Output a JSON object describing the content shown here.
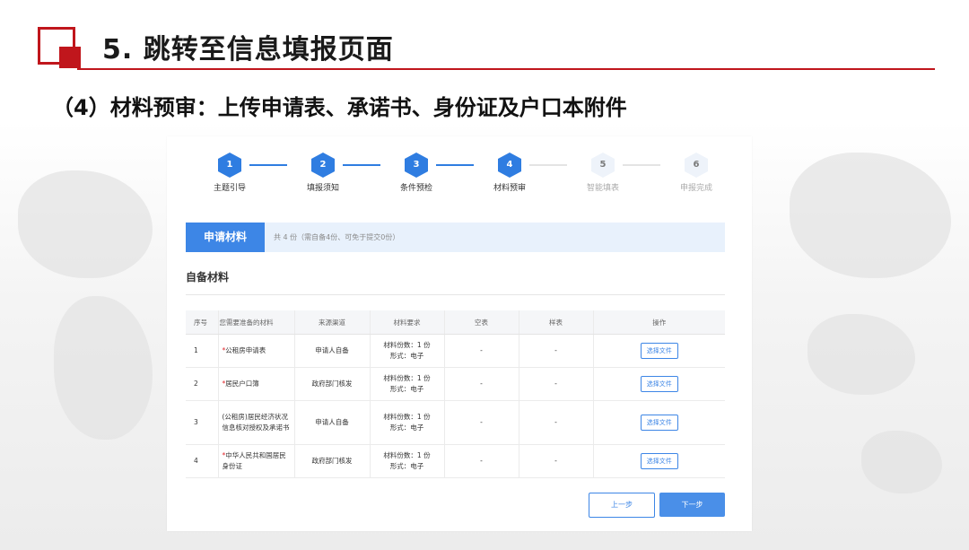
{
  "slide": {
    "title": "5. 跳转至信息填报页面",
    "subtitle": "（4）材料预审：上传申请表、承诺书、身份证及户口本附件"
  },
  "steps": [
    {
      "num": "1",
      "label": "主题引导",
      "state": "active"
    },
    {
      "num": "2",
      "label": "填报须知",
      "state": "active"
    },
    {
      "num": "3",
      "label": "条件预检",
      "state": "active"
    },
    {
      "num": "4",
      "label": "材料预审",
      "state": "active"
    },
    {
      "num": "5",
      "label": "智能填表",
      "state": "inactive"
    },
    {
      "num": "6",
      "label": "申报完成",
      "state": "inactive"
    }
  ],
  "apply": {
    "tab_label": "申请材料",
    "count_text": "共 4 份（需自备4份、可免于提交0份）"
  },
  "section_title": "自备材料",
  "table": {
    "headers": [
      "序号",
      "您需要准备的材料",
      "来源渠道",
      "材料要求",
      "空表",
      "样表",
      "操作"
    ],
    "rows": [
      {
        "idx": "1",
        "req_mark": "*",
        "name": "公租房申请表",
        "source": "申请人自备",
        "count": "材料份数：1 份",
        "form": "形式：电子",
        "blank": "-",
        "sample": "-",
        "action": "选择文件"
      },
      {
        "idx": "2",
        "req_mark": "*",
        "name": "居民户口簿",
        "source": "政府部门核发",
        "count": "材料份数：1 份",
        "form": "形式：电子",
        "blank": "-",
        "sample": "-",
        "action": "选择文件"
      },
      {
        "idx": "3",
        "req_mark": "",
        "name": "(公租房)居民经济状况信息核对授权及承诺书",
        "source": "申请人自备",
        "count": "材料份数：1 份",
        "form": "形式：电子",
        "blank": "-",
        "sample": "-",
        "action": "选择文件"
      },
      {
        "idx": "4",
        "req_mark": "*",
        "name": "中华人民共和国居民身份证",
        "source": "政府部门核发",
        "count": "材料份数：1 份",
        "form": "形式：电子",
        "blank": "-",
        "sample": "-",
        "action": "选择文件"
      }
    ]
  },
  "buttons": {
    "prev": "上一步",
    "next": "下一步"
  },
  "colors": {
    "brand_red": "#c0161c",
    "primary_blue": "#3d86e6",
    "required_red": "#e0262b"
  }
}
